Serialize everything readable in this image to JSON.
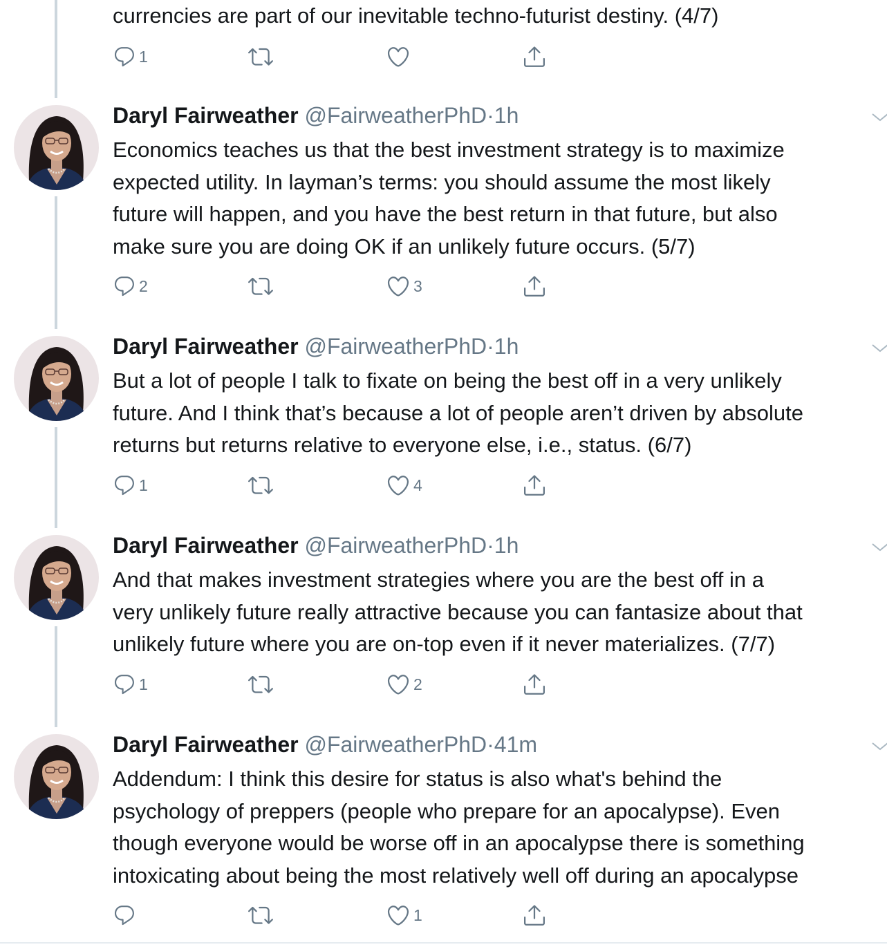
{
  "partial_tweet": {
    "text": "currencies are part of our inevitable techno-futurist destiny. (4/7)",
    "reply_count": "1",
    "retweet_count": "",
    "like_count": ""
  },
  "tweets": [
    {
      "name": "Daryl Fairweather",
      "handle": "@FairweatherPhD",
      "dot": "·",
      "time": "1h",
      "text": "Economics teaches us that the best investment strategy is to maximize\nexpected utility. In layman’s terms: you should assume the most likely\nfuture will happen, and you have the best return in that future, but also\nmake sure you are doing OK if an unlikely future occurs. (5/7)",
      "reply_count": "2",
      "retweet_count": "",
      "like_count": "3"
    },
    {
      "name": "Daryl Fairweather",
      "handle": "@FairweatherPhD",
      "dot": "·",
      "time": "1h",
      "text": "But a lot of people I talk to fixate on being the best off in a very unlikely\nfuture. And I think that’s because a lot of people aren’t driven by absolute\nreturns but returns relative to everyone else, i.e., status. (6/7)",
      "reply_count": "1",
      "retweet_count": "",
      "like_count": "4"
    },
    {
      "name": "Daryl Fairweather",
      "handle": "@FairweatherPhD",
      "dot": "·",
      "time": "1h",
      "text": "And that makes investment strategies where you are the best off in a\nvery unlikely future really attractive because you can fantasize about that\nunlikely future where you are on-top even if it never materializes. (7/7)",
      "reply_count": "1",
      "retweet_count": "",
      "like_count": "2"
    },
    {
      "name": "Daryl Fairweather",
      "handle": "@FairweatherPhD",
      "dot": "·",
      "time": "41m",
      "text": "Addendum: I think this desire for status is also what's behind the\npsychology of preppers (people who prepare for an apocalypse). Even\nthough everyone would be worse off in an apocalypse there is something\nintoxicating about being the most relatively well off during an apocalypse",
      "reply_count": "",
      "retweet_count": "",
      "like_count": "1"
    }
  ],
  "icons": {
    "reply": "reply-icon",
    "retweet": "retweet-icon",
    "like": "heart-icon",
    "share": "share-icon",
    "caret": "chevron-down-icon",
    "avatar": "avatar"
  },
  "colors": {
    "text": "#14171a",
    "secondary": "#657786",
    "thread_line": "#ccd6dd"
  }
}
